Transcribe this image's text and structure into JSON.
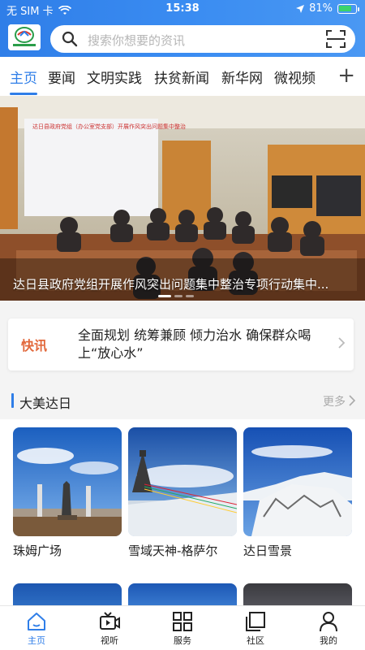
{
  "status_bar": {
    "carrier": "无 SIM 卡",
    "time": "15:38",
    "battery": "81%",
    "battery_level": 0.81
  },
  "search": {
    "placeholder": "搜索你想要的资讯"
  },
  "tabs": [
    {
      "label": "主页",
      "active": true
    },
    {
      "label": "要闻"
    },
    {
      "label": "文明实践"
    },
    {
      "label": "扶贫新闻"
    },
    {
      "label": "新华网"
    },
    {
      "label": "微视频"
    }
  ],
  "tabs_more": "+",
  "hero": {
    "caption": "达日县政府党组开展作风突出问题集中整治专项行动集中..."
  },
  "flash": {
    "tag": "快讯",
    "text": "全面规划 统筹兼顾 倾力治水 确保群众喝上“放心水”"
  },
  "section": {
    "title": "大美达日",
    "more": "更多",
    "cards": [
      {
        "label": "珠姆广场"
      },
      {
        "label": "雪域天神-格萨尔"
      },
      {
        "label": "达日雪景"
      }
    ]
  },
  "bottom_nav": [
    {
      "label": "主页",
      "icon": "home-icon",
      "active": true
    },
    {
      "label": "视听",
      "icon": "video-icon"
    },
    {
      "label": "服务",
      "icon": "grid-icon"
    },
    {
      "label": "社区",
      "icon": "community-icon"
    },
    {
      "label": "我的",
      "icon": "user-icon"
    }
  ],
  "colors": {
    "accent": "#2f7ee8",
    "flash_tag": "#e2683b"
  }
}
